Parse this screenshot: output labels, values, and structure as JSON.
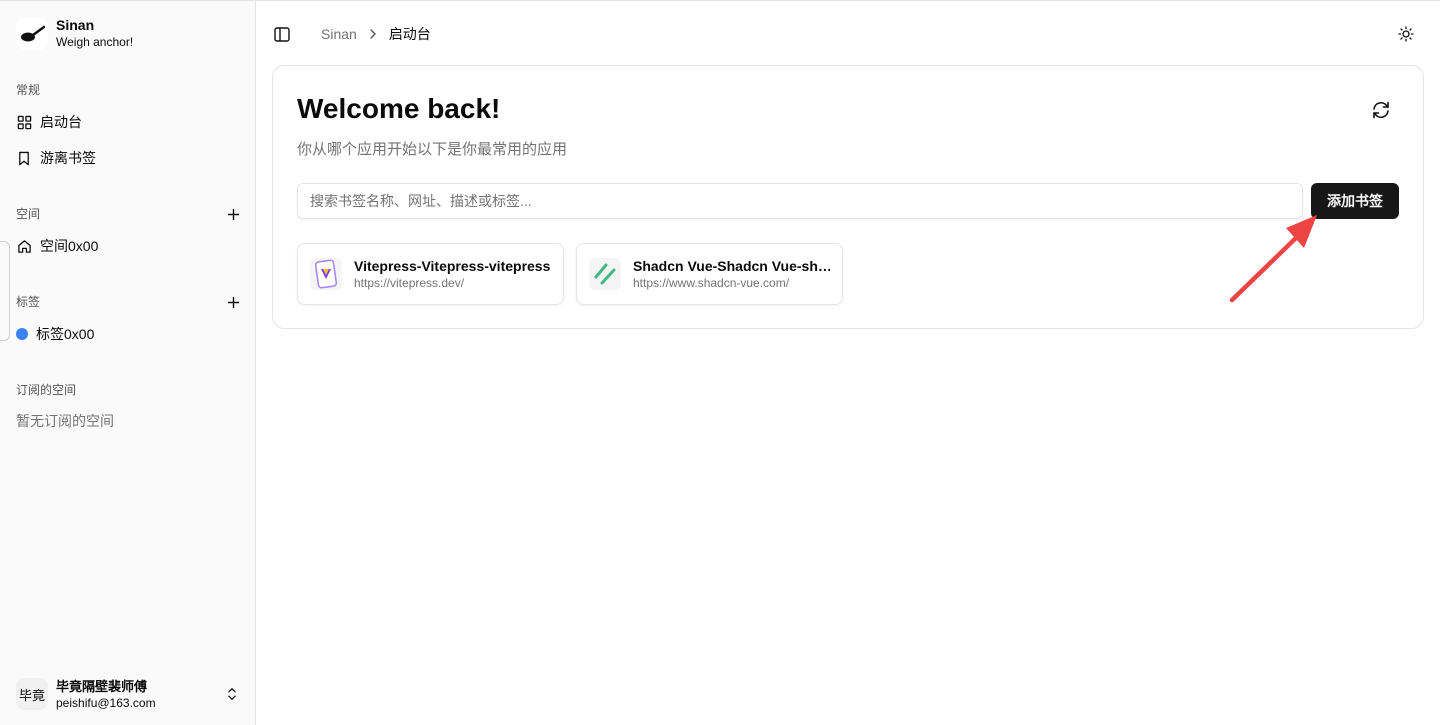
{
  "brand": {
    "name": "Sinan",
    "tagline": "Weigh anchor!"
  },
  "sidebar": {
    "general": {
      "label": "常规",
      "items": [
        {
          "label": "启动台",
          "icon": "grid-icon"
        },
        {
          "label": "游离书签",
          "icon": "bookmark-icon"
        }
      ]
    },
    "spaces": {
      "label": "空间",
      "items": [
        {
          "label": "空间0x00",
          "icon": "home-icon"
        }
      ]
    },
    "tags": {
      "label": "标签",
      "items": [
        {
          "label": "标签0x00",
          "color": "#3b82f6"
        }
      ]
    },
    "subscribed": {
      "label": "订阅的空间",
      "empty_text": "暂无订阅的空间"
    }
  },
  "user": {
    "avatar_text": "毕竟",
    "name": "毕竟隔壁裴师傅",
    "email": "peishifu@163.com"
  },
  "breadcrumb": {
    "root": "Sinan",
    "current": "启动台"
  },
  "main": {
    "title": "Welcome back!",
    "subtitle": "你从哪个应用开始以下是你最常用的应用",
    "search_placeholder": "搜索书签名称、网址、描述或标签...",
    "add_button_label": "添加书签",
    "bookmarks": [
      {
        "title": "Vitepress-Vitepress-vitepress",
        "url": "https://vitepress.dev/",
        "icon": "vitepress-logo-icon"
      },
      {
        "title": "Shadcn Vue-Shadcn Vue-shadcn",
        "url": "https://www.shadcn-vue.com/",
        "icon": "shadcn-logo-icon"
      }
    ]
  },
  "colors": {
    "primary": "#171717",
    "tag": "#3b82f6",
    "arrow": "#ef4444"
  }
}
